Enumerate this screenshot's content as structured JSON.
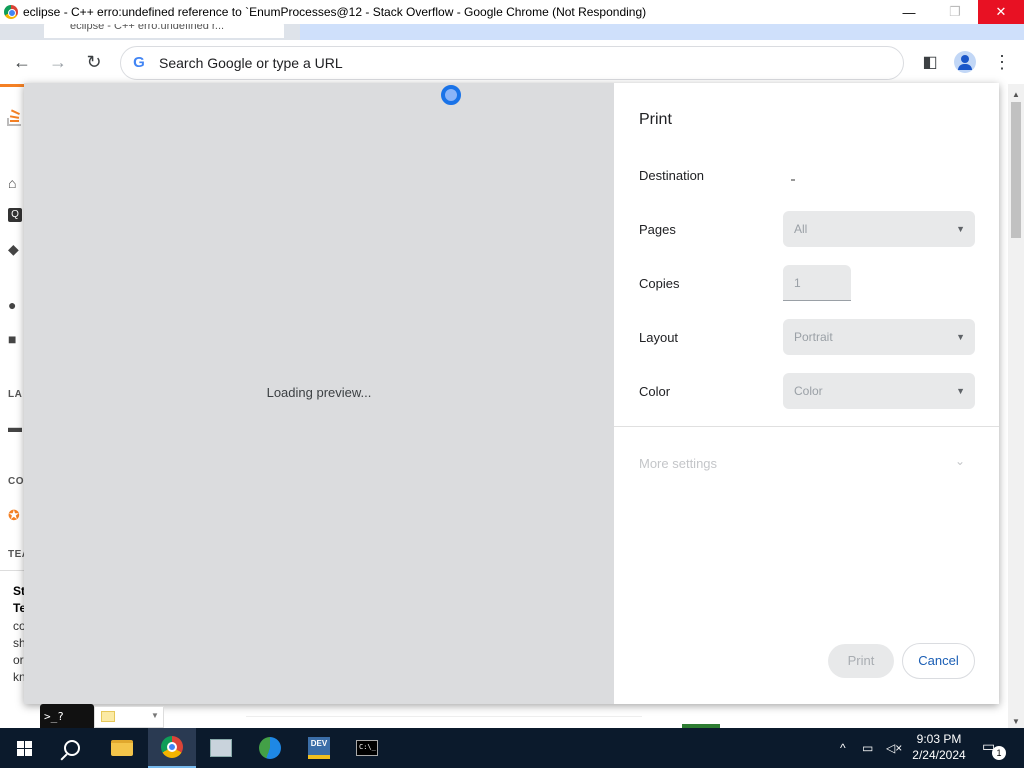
{
  "window": {
    "title": "eclipse - C++ erro:undefined reference to `EnumProcesses@12 - Stack Overflow - Google Chrome (Not Responding)",
    "minimize_glyph": "—",
    "maximize_glyph": "❐",
    "close_glyph": "✕"
  },
  "tab": {
    "fragment_text": "eclipse - C++ erro:undefined r..."
  },
  "toolbar": {
    "back_glyph": "←",
    "forward_glyph": "→",
    "reload_glyph": "↻",
    "omnibox_placeholder": "Search Google or type a URL",
    "google_glyph": "G",
    "sidepanel_glyph": "◧",
    "menu_glyph": "⋮"
  },
  "background_page": {
    "sidebar_labels": [
      "LA",
      "CO",
      "TEA"
    ],
    "teams_text": [
      {
        "text": "St",
        "bold": true
      },
      {
        "text": "Te",
        "bold": true
      },
      {
        "text": "co",
        "bold": false
      },
      {
        "text": "sh",
        "bold": false
      },
      {
        "text": "or",
        "bold": false
      },
      {
        "text": "kn",
        "bold": false
      }
    ],
    "icons": [
      "home-icon",
      "questions-icon",
      "tags-icon",
      "users-icon",
      "jobs-icon",
      "chat-icon",
      "collectives-icon"
    ]
  },
  "print_dialog": {
    "title": "Print",
    "preview_status": "Loading preview...",
    "destination_label": "Destination",
    "pages_label": "Pages",
    "pages_value": "All",
    "copies_label": "Copies",
    "copies_value": "1",
    "layout_label": "Layout",
    "layout_value": "Portrait",
    "color_label": "Color",
    "color_value": "Color",
    "more_settings_label": "More settings",
    "print_button": "Print",
    "cancel_button": "Cancel"
  },
  "bottom": {
    "console_text": ">_?"
  },
  "taskbar": {
    "time": "9:03 PM",
    "date": "2/24/2024",
    "notification_count": "1",
    "dev_label": "DEV",
    "terminal_label": "C:\\_"
  },
  "colors": {
    "accent_blue": "#1a73e8",
    "cancel_text": "#1a5eb5",
    "close_red": "#e81123",
    "taskbar_bg": "#0b1a2c",
    "so_orange": "#f48024"
  }
}
